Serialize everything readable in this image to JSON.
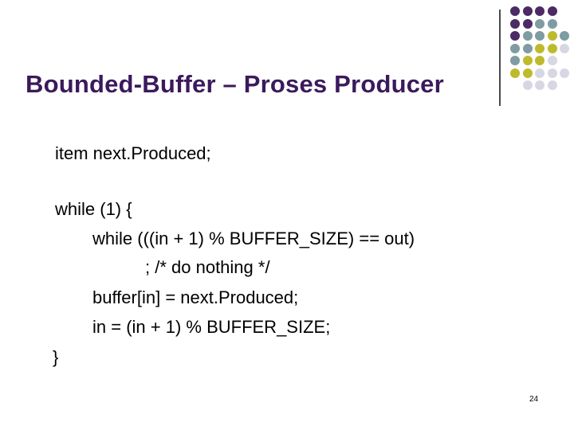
{
  "slide": {
    "title": "Bounded-Buffer – Proses Producer",
    "code": {
      "declaration": "item next.Produced;",
      "while_outer": "while (1) {",
      "while_inner": "while (((in + 1) % BUFFER_SIZE) == out)",
      "do_nothing": "; /* do nothing */",
      "buffer_assign": "buffer[in] = next.Produced;",
      "in_update": "in = (in + 1) % BUFFER_SIZE;",
      "close_brace": "}"
    },
    "page_number": "24"
  },
  "decoration": {
    "colors": {
      "purple": "#4b2a66",
      "teal": "#7e9ca2",
      "olive": "#bdbb2c",
      "lavender": "#d7d7e4"
    },
    "dot_rows": [
      [
        "purple",
        "purple",
        "purple",
        "purple",
        "",
        ""
      ],
      [
        "purple",
        "purple",
        "teal",
        "teal",
        "",
        ""
      ],
      [
        "purple",
        "teal",
        "teal",
        "olive",
        "teal",
        ""
      ],
      [
        "teal",
        "teal",
        "olive",
        "olive",
        "lavender",
        ""
      ],
      [
        "teal",
        "olive",
        "olive",
        "lavender",
        "",
        ""
      ],
      [
        "olive",
        "olive",
        "lavender",
        "lavender",
        "lavender",
        ""
      ],
      [
        "",
        "lavender",
        "lavender",
        "lavender",
        "",
        ""
      ]
    ]
  }
}
